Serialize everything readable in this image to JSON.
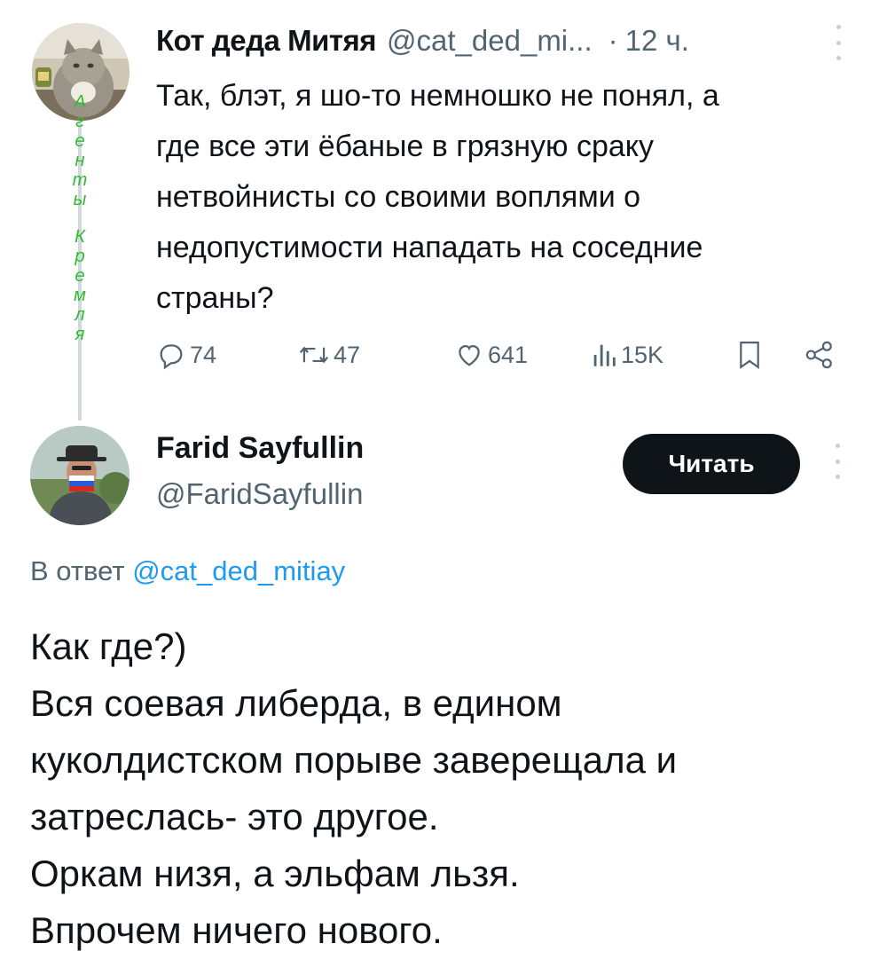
{
  "parent_tweet": {
    "author_name": "Кот деда Митяя",
    "author_handle": "@cat_ded_mi...",
    "separator": "·",
    "time": "12 ч.",
    "avatar_caption_word1": [
      "А",
      "г",
      "е",
      "н",
      "т",
      "ы"
    ],
    "avatar_caption_word2": [
      "К",
      "р",
      "е",
      "м",
      "л",
      "я"
    ],
    "text_lines": [
      "Так, блэт, я шо-то немношко не понял, а",
      "где все эти ёбаные в грязную сраку",
      "нетвойнисты со своими воплями о",
      "недопустимости нападать на соседние",
      "страны?"
    ],
    "actions": {
      "replies": "74",
      "retweets": "47",
      "likes": "641",
      "views": "15K"
    }
  },
  "reply_tweet": {
    "author_name": "Farid Sayfullin",
    "author_handle": "@FaridSayfullin",
    "follow_label": "Читать",
    "reply_prefix": "В ответ",
    "reply_mention": "@cat_ded_mitiay",
    "text_lines": [
      "Как где?)",
      "Вся соевая либерда, в едином",
      "куколдистском порыве заверещала и",
      "затреслась- это другое.",
      "Оркам низя, а эльфам льзя.",
      "Впрочем ничего нового."
    ]
  },
  "colors": {
    "text_primary": "#0f1419",
    "text_secondary": "#536471",
    "link": "#1d9bf0",
    "caption_green": "#2fbb2f",
    "button_bg": "#0f1419"
  }
}
